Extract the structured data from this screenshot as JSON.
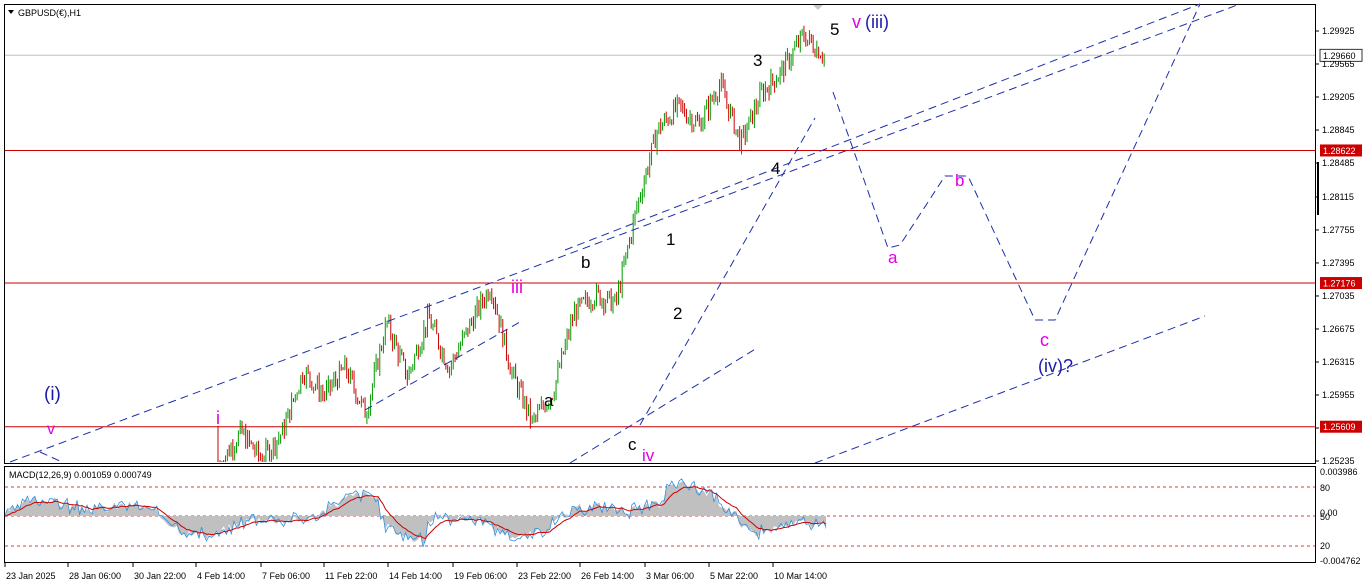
{
  "window_title": "GBPUSD(€),H1",
  "colors": {
    "wave_black": "#000000",
    "wave_magenta": "#e000e0",
    "wave_navy": "#1a1aa8",
    "projection_dashed": "#1c2fa8",
    "level_red": "#cc0000",
    "bull_candle": "#009900",
    "bear_candle": "#cc0000",
    "macd_hist": "#c0c0c0",
    "macd_main": "#2f8fe0",
    "macd_signal": "#cc0000",
    "current_price_bg": "#ffffff"
  },
  "price_axis": {
    "ticks": [
      "1.29925",
      "1.29565",
      "1.29205",
      "1.28845",
      "1.28485",
      "1.28115",
      "1.27755",
      "1.27395",
      "1.27035",
      "1.26675",
      "1.26315",
      "1.25955",
      "1.25595",
      "1.25235"
    ],
    "current_price": "1.29660",
    "levels": [
      "1.28622",
      "1.27176",
      "1.25609"
    ]
  },
  "macd_panel": {
    "label": "MACD(12,26,9) 0.001059 0.000749",
    "axis_ticks": [
      "0.003986",
      "80",
      "0.00",
      "50",
      "20",
      "-0.004762"
    ]
  },
  "time_axis": [
    "23 Jan 2025",
    "28 Jan 06:00",
    "30 Jan 22:00",
    "4 Feb 14:00",
    "7 Feb 06:00",
    "11 Feb 22:00",
    "14 Feb 14:00",
    "19 Feb 06:00",
    "23 Feb 22:00",
    "26 Feb 14:00",
    "3 Mar 06:00",
    "5 Mar 22:00",
    "10 Mar 14:00"
  ],
  "wave_labels": [
    {
      "text": "(i)",
      "color": "navy"
    },
    {
      "text": "v",
      "color": "magenta"
    },
    {
      "text": "i",
      "color": "magenta"
    },
    {
      "text": "iii",
      "color": "magenta"
    },
    {
      "text": "a",
      "color": "black"
    },
    {
      "text": "b",
      "color": "black"
    },
    {
      "text": "c",
      "color": "black"
    },
    {
      "text": "iv",
      "color": "magenta"
    },
    {
      "text": "1",
      "color": "black"
    },
    {
      "text": "2",
      "color": "black"
    },
    {
      "text": "3",
      "color": "black"
    },
    {
      "text": "4",
      "color": "black"
    },
    {
      "text": "5",
      "color": "black"
    },
    {
      "text": "v",
      "color": "magenta"
    },
    {
      "text": "(iii)",
      "color": "navy"
    },
    {
      "text": "a",
      "color": "magenta"
    },
    {
      "text": "b",
      "color": "magenta"
    },
    {
      "text": "c",
      "color": "magenta"
    },
    {
      "text": "(iv)?",
      "color": "navy"
    }
  ],
  "chart_data": {
    "type": "candlestick",
    "symbol": "GBPUSD(€)",
    "timeframe": "H1",
    "ylim": [
      1.252,
      1.301
    ],
    "horizontal_levels": [
      1.28622,
      1.27176,
      1.25609
    ],
    "current_price": 1.2966,
    "price_path": [
      {
        "t": "23 Jan 2025",
        "price": 1.252
      },
      {
        "t": "4 Feb 14:00",
        "price": 1.2555
      },
      {
        "t": "11 Feb 22:00",
        "price": 1.2525
      },
      {
        "t": "12 Feb",
        "price": 1.2555
      },
      {
        "t": "13 Feb",
        "price": 1.2622
      },
      {
        "t": "14 Feb 14:00",
        "price": 1.2595
      },
      {
        "t": "17 Feb",
        "price": 1.2625
      },
      {
        "t": "19 Feb 06:00",
        "price": 1.2575
      },
      {
        "t": "20 Feb",
        "price": 1.2675
      },
      {
        "t": "21 Feb",
        "price": 1.2615
      },
      {
        "t": "21 Feb late",
        "price": 1.268
      },
      {
        "t": "23 Feb 22:00",
        "price": 1.2625
      },
      {
        "t": "24 Feb",
        "price": 1.2672
      },
      {
        "t": "25 Feb",
        "price": 1.2715
      },
      {
        "t": "26 Feb",
        "price": 1.262
      },
      {
        "t": "26 Feb 14:00",
        "price": 1.2565
      },
      {
        "t": "28 Feb",
        "price": 1.26
      },
      {
        "t": "3 Mar 06:00",
        "price": 1.2685
      },
      {
        "t": "3 Mar late",
        "price": 1.2705
      },
      {
        "t": "4 Mar",
        "price": 1.2695
      },
      {
        "t": "4 Mar late",
        "price": 1.28
      },
      {
        "t": "5 Mar",
        "price": 1.2885
      },
      {
        "t": "5 Mar 22:00",
        "price": 1.291
      },
      {
        "t": "6 Mar",
        "price": 1.289
      },
      {
        "t": "7 Mar",
        "price": 1.2935
      },
      {
        "t": "10 Mar",
        "price": 1.287
      },
      {
        "t": "10 Mar 14:00",
        "price": 1.2925
      },
      {
        "t": "11 Mar",
        "price": 1.295
      },
      {
        "t": "12 Mar",
        "price": 1.2988
      },
      {
        "t": "12 Mar late",
        "price": 1.2966
      }
    ],
    "projection_path": [
      1.2955,
      1.277,
      1.284,
      1.268,
      1.302
    ],
    "projection_labels": [
      "a",
      "b",
      "c",
      "(iv)?"
    ],
    "macd": {
      "main": 0.001059,
      "signal": 0.000749,
      "range": [
        -0.004762,
        0.003986
      ]
    }
  }
}
